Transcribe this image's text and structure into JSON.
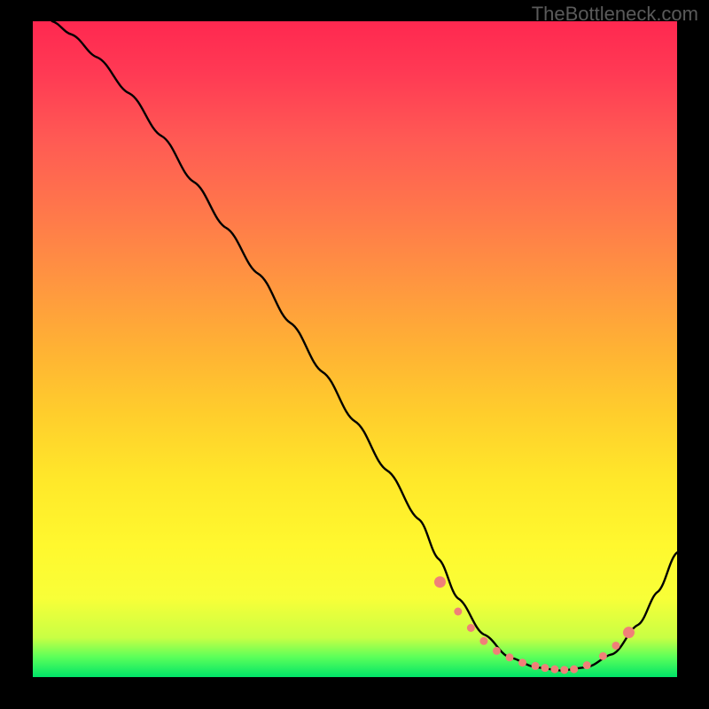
{
  "watermark": "TheBottleneck.com",
  "chart_data": {
    "type": "line",
    "title": "",
    "xlabel": "",
    "ylabel": "",
    "xlim": [
      0,
      100
    ],
    "ylim": [
      0,
      100
    ],
    "series": [
      {
        "name": "curve",
        "x": [
          3,
          6,
          10,
          15,
          20,
          25,
          30,
          35,
          40,
          45,
          50,
          55,
          60,
          63,
          66,
          70,
          74,
          78,
          82,
          86,
          90,
          94,
          97,
          100
        ],
        "y": [
          100,
          98,
          94.5,
          89,
          82.5,
          75.5,
          68.5,
          61.5,
          54,
          46.5,
          39,
          31.5,
          24,
          18,
          12,
          6.5,
          3,
          1.5,
          1,
          1.5,
          3.5,
          8,
          13,
          19
        ]
      }
    ],
    "markers": {
      "name": "salmon-dots",
      "color": "#f08078",
      "x": [
        63.2,
        66,
        68,
        70,
        72,
        74,
        76,
        78,
        79.5,
        81,
        82.5,
        84,
        86,
        88.5,
        90.5,
        92.5
      ],
      "y": [
        14.5,
        10,
        7.5,
        5.5,
        4,
        3,
        2.2,
        1.7,
        1.4,
        1.2,
        1.1,
        1.2,
        1.8,
        3.2,
        4.8,
        6.8
      ]
    },
    "background": {
      "type": "vertical-gradient",
      "stops": [
        {
          "pos": 0,
          "color": "#ff2850"
        },
        {
          "pos": 50,
          "color": "#ffce2c"
        },
        {
          "pos": 88,
          "color": "#f8ff38"
        },
        {
          "pos": 100,
          "color": "#00e468"
        }
      ]
    }
  }
}
